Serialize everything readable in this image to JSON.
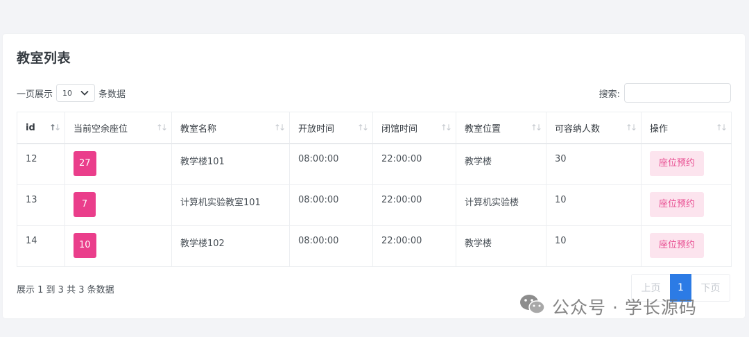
{
  "page": {
    "title": "教室列表"
  },
  "length_menu": {
    "prefix": "一页展示",
    "selected": "10",
    "suffix": "条数据"
  },
  "search": {
    "label": "搜索:",
    "value": "",
    "placeholder": ""
  },
  "table": {
    "headers": [
      "id",
      "当前空余座位",
      "教室名称",
      "开放时间",
      "闭馆时间",
      "教室位置",
      "可容纳人数",
      "操作"
    ],
    "rows": [
      {
        "id": "12",
        "seats": "27",
        "name": "教学楼101",
        "open": "08:00:00",
        "close": "22:00:00",
        "location": "教学楼",
        "capacity": "30",
        "action": "座位预约"
      },
      {
        "id": "13",
        "seats": "7",
        "name": "计算机实验教室101",
        "open": "08:00:00",
        "close": "22:00:00",
        "location": "计算机实验楼",
        "capacity": "10",
        "action": "座位预约"
      },
      {
        "id": "14",
        "seats": "10",
        "name": "教学楼102",
        "open": "08:00:00",
        "close": "22:00:00",
        "location": "教学楼",
        "capacity": "10",
        "action": "座位预约"
      }
    ]
  },
  "footer": {
    "info": "展示 1 到 3 共 3 条数据"
  },
  "pagination": {
    "prev": "上页",
    "current": "1",
    "next": "下页"
  },
  "watermark": {
    "text": "公众号 · 学长源码"
  },
  "colors": {
    "badge": "#ea3e8b",
    "action_bg": "#fce4ee",
    "action_text": "#e84a8f",
    "page_active": "#2c7be5"
  }
}
